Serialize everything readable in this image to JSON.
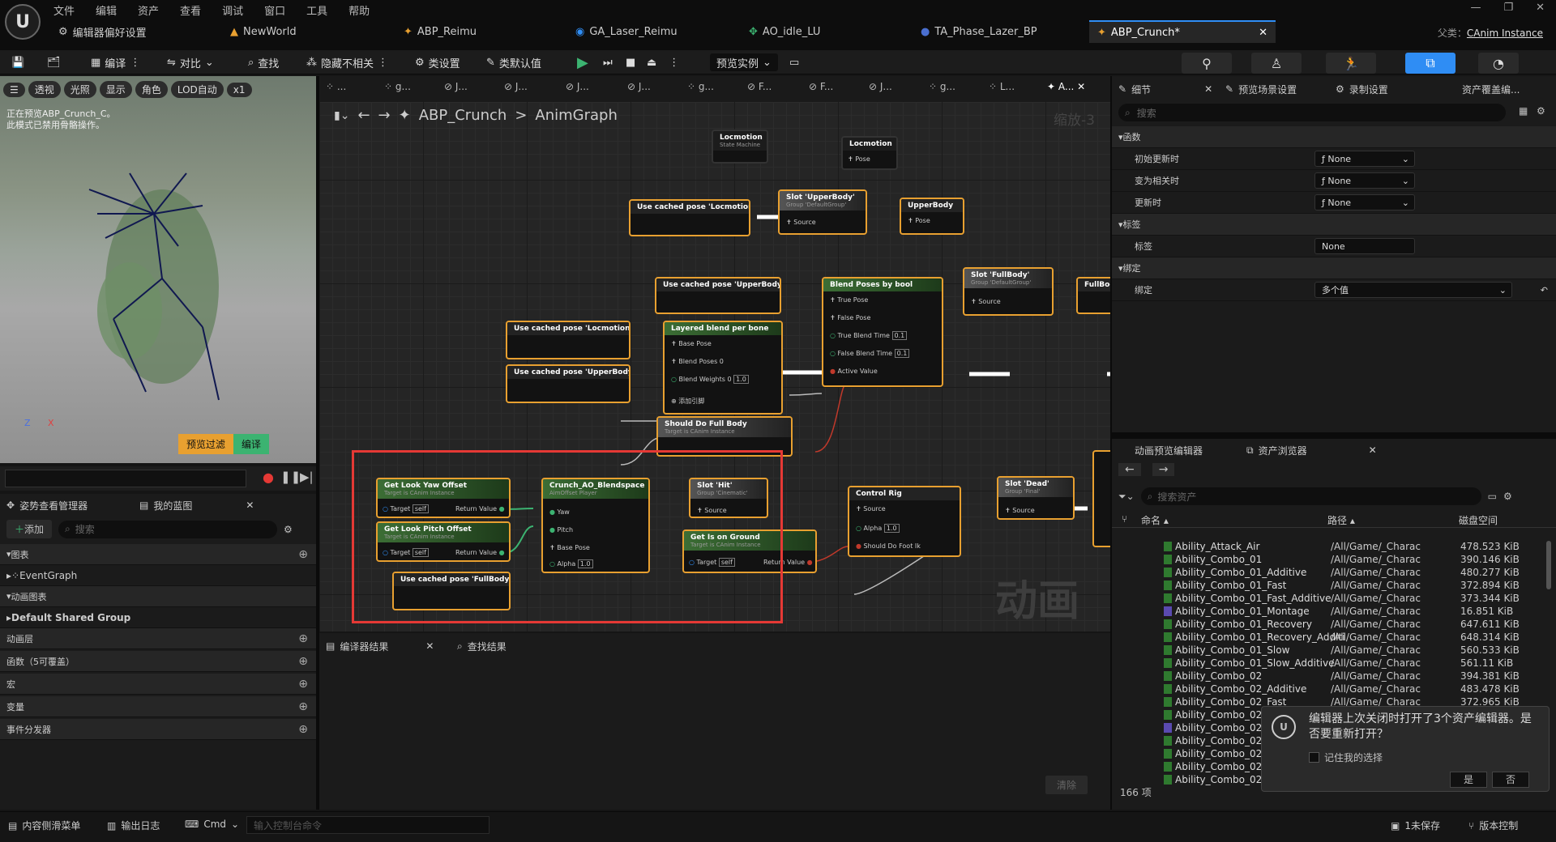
{
  "menu": [
    "文件",
    "编辑",
    "资产",
    "查看",
    "调试",
    "窗口",
    "工具",
    "帮助"
  ],
  "doc_tabs": [
    "编辑器偏好设置",
    "NewWorld",
    "ABP_Reimu",
    "GA_Laser_Reimu",
    "AO_idle_LU",
    "TA_Phase_Lazer_BP",
    "ABP_Crunch*"
  ],
  "parent_class": {
    "label": "父类：",
    "value": "CAnim Instance"
  },
  "toolbar": {
    "compile": "编译",
    "diff": "对比",
    "find": "查找",
    "hide_unrelated": "隐藏不相关",
    "class_settings": "类设置",
    "class_defaults": "类默认值",
    "preview_instance": "预览实例"
  },
  "viewport": {
    "chips": [
      "透视",
      "光照",
      "显示",
      "角色",
      "LOD自动",
      "x1"
    ],
    "note_line1": "正在预览ABP_Crunch_C。",
    "note_line2": "此模式已禁用骨骼操作。",
    "axis_z": "Z",
    "axis_x": "X",
    "btn_preview_filter": "预览过滤",
    "btn_compile": "编译"
  },
  "left_panel": {
    "tab_pose": "姿势查看管理器",
    "tab_mybp": "我的蓝图",
    "add": "添加",
    "search_placeholder": "搜索",
    "rows": [
      "图表",
      "EventGraph",
      "动画图表",
      "Default Shared Group",
      "动画层",
      "函数（5可覆盖）",
      "宏",
      "变量",
      "事件分发器"
    ]
  },
  "graph": {
    "tabs": [
      "g...",
      "J...",
      "J...",
      "J...",
      "J...",
      "g...",
      "F...",
      "F...",
      "J...",
      "g...",
      "L...",
      "A..."
    ],
    "breadcrumb_root": "ABP_Crunch",
    "breadcrumb_sep": ">",
    "breadcrumb_leaf": "AnimGraph",
    "zoom": "缩放-3",
    "watermark": "动画",
    "nodes": {
      "locmotion_sm": "Locmotion",
      "locmotion_sm_sub": "State Machine",
      "locmotion_cache": "Locmotion",
      "pose": "Pose",
      "use_cached_loc_top": "Use cached pose 'Locmotion'",
      "slot_upper": "Slot 'UpperBody'",
      "slot_upper_sub": "Group 'DefaultGroup'",
      "source": "Source",
      "upper_cache": "UpperBody",
      "use_cached_upper_1": "Use cached pose 'UpperBody'",
      "blend_bool": "Blend Poses by bool",
      "true_pose": "True Pose",
      "false_pose": "False Pose",
      "true_blend_time": "True Blend Time",
      "false_blend_time": "False Blend Time",
      "blend_time_val": "0.1",
      "active_value": "Active Value",
      "slot_full": "Slot 'FullBody'",
      "slot_full_sub": "Group 'DefaultGroup'",
      "fullbody_cache": "FullBod",
      "use_cached_loc_mid": "Use cached pose 'Locmotion'",
      "use_cached_upper_2": "Use cached pose 'UpperBody'",
      "layered": "Layered blend per bone",
      "base_pose": "Base Pose",
      "blend_poses0": "Blend Poses 0",
      "blend_weights0": "Blend Weights 0",
      "weight_val": "1.0",
      "add_pin": "添加引脚",
      "should_full": "Should Do Full Body",
      "target_anim": "Target is CAnim Instance",
      "get_yaw": "Get Look Yaw Offset",
      "get_pitch": "Get Look Pitch Offset",
      "target": "Target",
      "self": "self",
      "return_value": "Return Value",
      "crunch_ao": "Crunch_AO_Blendspace",
      "ao_player": "AimOffset Player",
      "yaw": "Yaw",
      "pitch": "Pitch",
      "alpha": "Alpha",
      "use_cached_full": "Use cached pose 'FullBody'",
      "slot_hit": "Slot 'Hit'",
      "slot_hit_sub": "Group 'Cinematic'",
      "get_ground": "Get Is on Ground",
      "control_rig": "Control Rig",
      "should_foot_ik": "Should Do Foot Ik",
      "slot_dead": "Slot 'Dead'",
      "slot_dead_sub": "Group 'Final'"
    }
  },
  "compiler": {
    "tab_results": "编译器结果",
    "tab_find": "查找结果",
    "clear": "清除"
  },
  "details": {
    "tabs": [
      "细节",
      "预览场景设置",
      "录制设置",
      "资产覆盖编..."
    ],
    "search_placeholder": "搜索",
    "section_functions": "函数",
    "rows": [
      {
        "label": "初始更新时",
        "value": "None"
      },
      {
        "label": "变为相关时",
        "value": "None"
      },
      {
        "label": "更新时",
        "value": "None"
      }
    ],
    "section_tags": "标签",
    "tag_label": "标签",
    "tag_value": "None",
    "section_bind": "绑定",
    "bind_label": "绑定",
    "bind_value": "多个值"
  },
  "assets": {
    "tab_anim_preview": "动画预览编辑器",
    "tab_browser": "资产浏览器",
    "search_placeholder": "搜索资产",
    "col_name": "命名",
    "col_path": "路径",
    "col_disk": "磁盘空间",
    "rows": [
      {
        "name": "Ability_Attack_Air",
        "path": "/All/Game/_Charac",
        "size": "478.523 KiB",
        "color": "green"
      },
      {
        "name": "Ability_Combo_01",
        "path": "/All/Game/_Charac",
        "size": "390.146 KiB",
        "color": "green"
      },
      {
        "name": "Ability_Combo_01_Additive",
        "path": "/All/Game/_Charac",
        "size": "480.277 KiB",
        "color": "green"
      },
      {
        "name": "Ability_Combo_01_Fast",
        "path": "/All/Game/_Charac",
        "size": "372.894 KiB",
        "color": "green"
      },
      {
        "name": "Ability_Combo_01_Fast_Additive",
        "path": "/All/Game/_Charac",
        "size": "373.344 KiB",
        "color": "green"
      },
      {
        "name": "Ability_Combo_01_Montage",
        "path": "/All/Game/_Charac",
        "size": "16.851 KiB",
        "color": "blue"
      },
      {
        "name": "Ability_Combo_01_Recovery",
        "path": "/All/Game/_Charac",
        "size": "647.611 KiB",
        "color": "green"
      },
      {
        "name": "Ability_Combo_01_Recovery_Additi",
        "path": "/All/Game/_Charac",
        "size": "648.314 KiB",
        "color": "green"
      },
      {
        "name": "Ability_Combo_01_Slow",
        "path": "/All/Game/_Charac",
        "size": "560.533 KiB",
        "color": "green"
      },
      {
        "name": "Ability_Combo_01_Slow_Additive",
        "path": "/All/Game/_Charac",
        "size": "561.11 KiB",
        "color": "green"
      },
      {
        "name": "Ability_Combo_02",
        "path": "/All/Game/_Charac",
        "size": "394.381 KiB",
        "color": "green"
      },
      {
        "name": "Ability_Combo_02_Additive",
        "path": "/All/Game/_Charac",
        "size": "483.478 KiB",
        "color": "green"
      },
      {
        "name": "Ability_Combo_02_Fast",
        "path": "/All/Game/_Charac",
        "size": "372.965 KiB",
        "color": "green"
      },
      {
        "name": "Ability_Combo_02_Fa",
        "path": "",
        "size": "",
        "color": "green"
      },
      {
        "name": "Ability_Combo_02_M",
        "path": "",
        "size": "",
        "color": "blue"
      },
      {
        "name": "Ability_Combo_02_Re",
        "path": "",
        "size": "",
        "color": "green"
      },
      {
        "name": "Ability_Combo_02_Re",
        "path": "",
        "size": "",
        "color": "green"
      },
      {
        "name": "Ability_Combo_02_Sl",
        "path": "",
        "size": "",
        "color": "green"
      },
      {
        "name": "Ability_Combo_02_Sl",
        "path": "",
        "size": "",
        "color": "green"
      }
    ],
    "count": "166 项"
  },
  "popup": {
    "message": "编辑器上次关闭时打开了3个资产编辑器。是否要重新打开？",
    "remember": "记住我的选择",
    "yes": "是",
    "no": "否"
  },
  "statusbar": {
    "content_drawer": "内容侧滑菜单",
    "output_log": "输出日志",
    "cmd": "Cmd",
    "console_placeholder": "输入控制台命令",
    "unsaved": "1未保存",
    "source_control": "版本控制"
  },
  "colors": {
    "accent": "#2f8df4",
    "node_border": "#e8a030",
    "highlight": "#e53935",
    "exec_green": "#3cb371"
  }
}
